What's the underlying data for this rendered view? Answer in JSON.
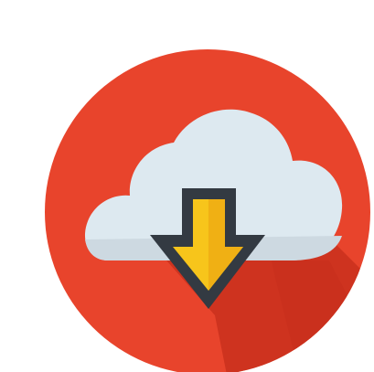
{
  "icon": {
    "name": "cloud-download-icon",
    "colors": {
      "circle": "#e8442c",
      "long_shadow": "#c9301d",
      "cloud": "#dde9f0",
      "cloud_shade": "#cdd9e1",
      "arrow_outline": "#333a42",
      "arrow_fill": "#f7c51b",
      "arrow_fill_shade": "#f0b014"
    }
  }
}
